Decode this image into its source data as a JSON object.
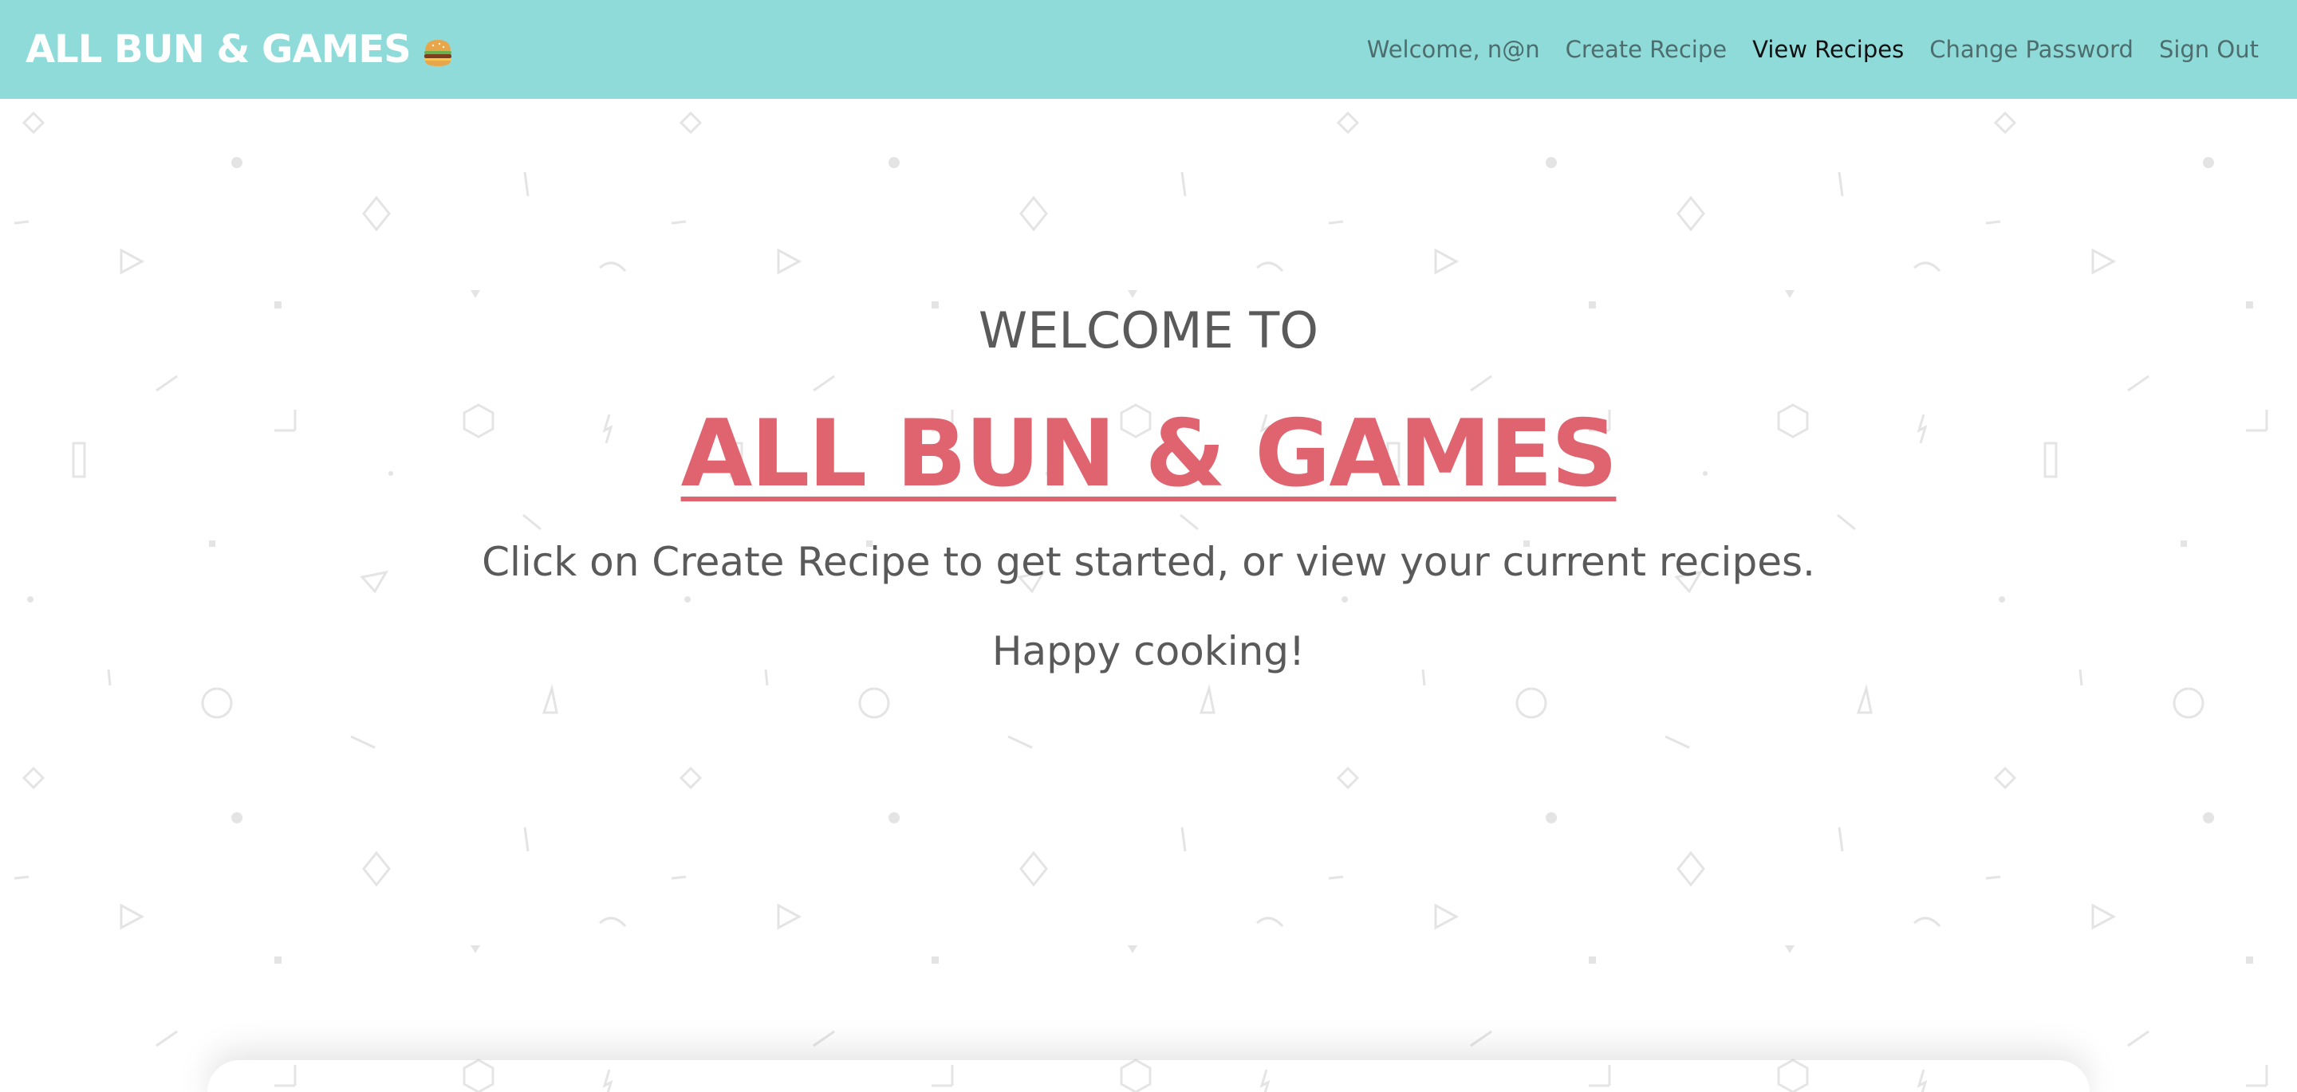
{
  "brand": {
    "name": "ALL BUN & GAMES",
    "icon": "burger-icon"
  },
  "nav": {
    "welcome": "Welcome, n@n",
    "create_recipe": "Create Recipe",
    "view_recipes": "View Recipes",
    "change_password": "Change Password",
    "sign_out": "Sign Out",
    "active": "View Recipes"
  },
  "hero": {
    "welcome_to": "WELCOME TO",
    "title": "ALL BUN & GAMES",
    "line1": "Click on Create Recipe to get started, or view your current recipes.",
    "line2": "Happy cooking!"
  },
  "colors": {
    "navbar": "#8fdbda",
    "title": "#e06470",
    "text": "#5a5a5a",
    "nav_link": "#4d6e6c",
    "nav_active": "#111111"
  }
}
